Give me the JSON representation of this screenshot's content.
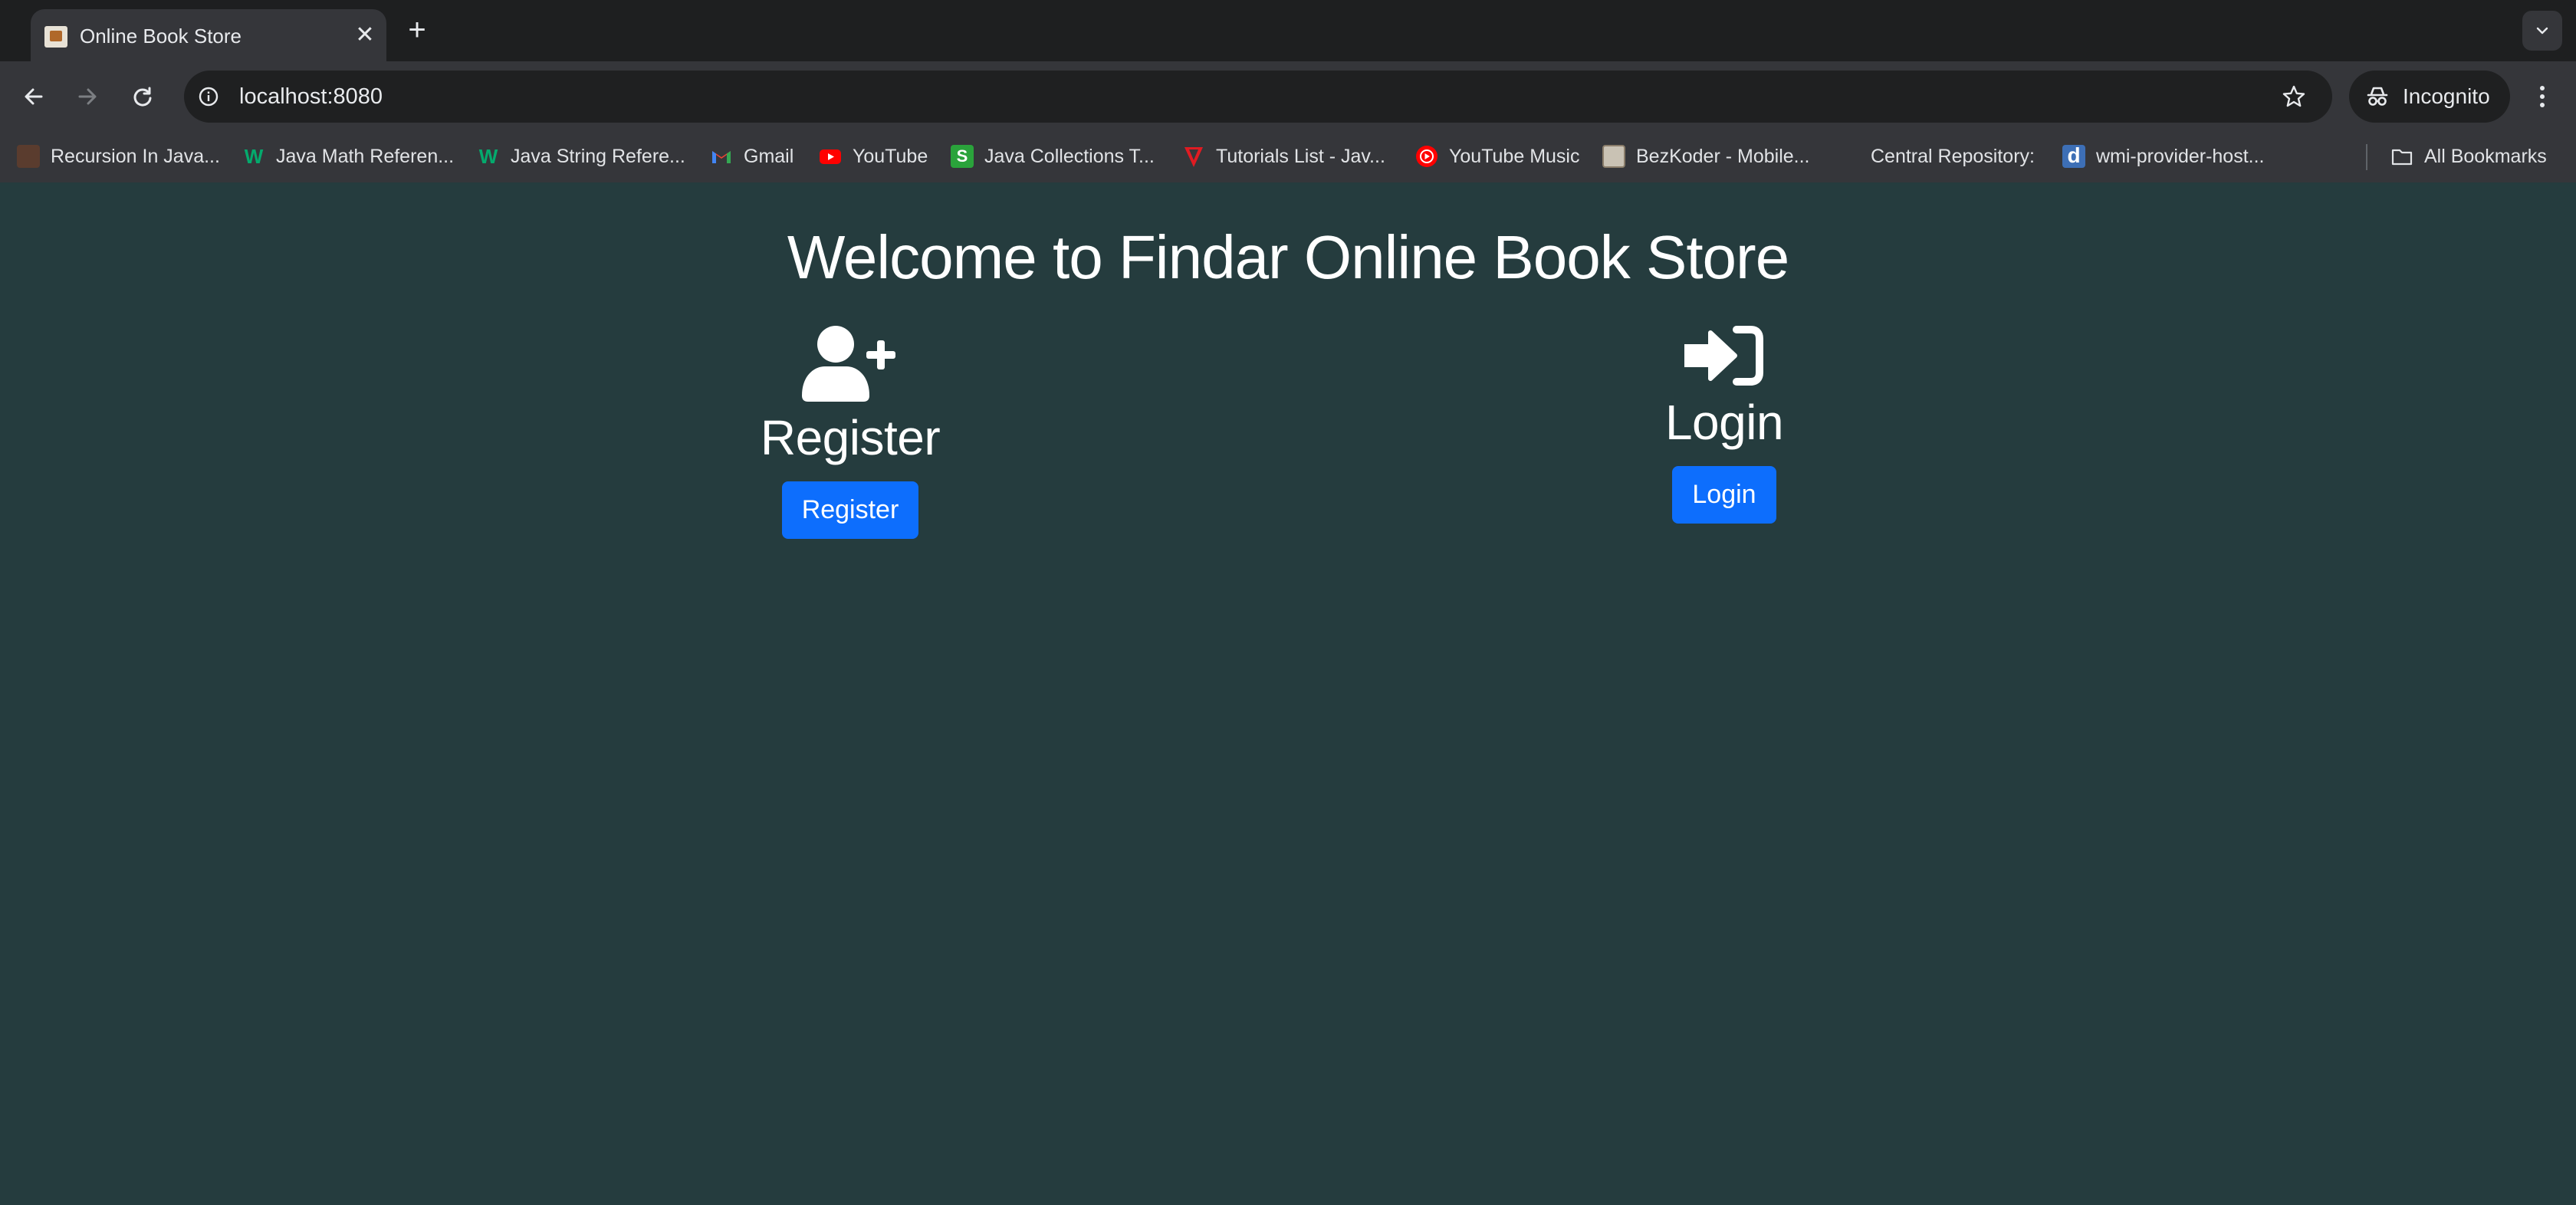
{
  "browser": {
    "tab": {
      "title": "Online Book Store",
      "close_symbol": "✕"
    },
    "new_tab_symbol": "+",
    "omnibox": {
      "url": "localhost:8080"
    },
    "incognito_label": "Incognito",
    "bookmarks": [
      {
        "label": "Recursion In Java...",
        "icon": "codecademy-icon",
        "color": "#5a3c2e"
      },
      {
        "label": "Java Math Referen...",
        "icon": "w3schools-icon",
        "color": "#04aa6d"
      },
      {
        "label": "Java String Refere...",
        "icon": "w3schools-icon",
        "color": "#04aa6d"
      },
      {
        "label": "Gmail",
        "icon": "gmail-icon",
        "color": "#ea4335"
      },
      {
        "label": "YouTube",
        "icon": "youtube-icon",
        "color": "#ff0000"
      },
      {
        "label": "Java Collections T...",
        "icon": "s-icon",
        "color": "#2aa33b"
      },
      {
        "label": "Tutorials List - Jav...",
        "icon": "tutorials-icon",
        "color": "#e01b22"
      },
      {
        "label": "YouTube Music",
        "icon": "youtube-music-icon",
        "color": "#ff0000"
      },
      {
        "label": "BezKoder - Mobile...",
        "icon": "bezkoder-icon",
        "color": "#c9c2b4"
      },
      {
        "label": "Central Repository:",
        "icon": "",
        "color": ""
      },
      {
        "label": "wmi-provider-host...",
        "icon": "d-icon",
        "color": "#3d6fb6"
      }
    ],
    "all_bookmarks_label": "All Bookmarks"
  },
  "page": {
    "title": "Welcome to Findar Online Book Store",
    "register": {
      "heading": "Register",
      "button": "Register"
    },
    "login": {
      "heading": "Login",
      "button": "Login"
    }
  },
  "colors": {
    "page_background": "#253c3e",
    "button_primary": "#0d6efd",
    "text": "#ffffff"
  }
}
